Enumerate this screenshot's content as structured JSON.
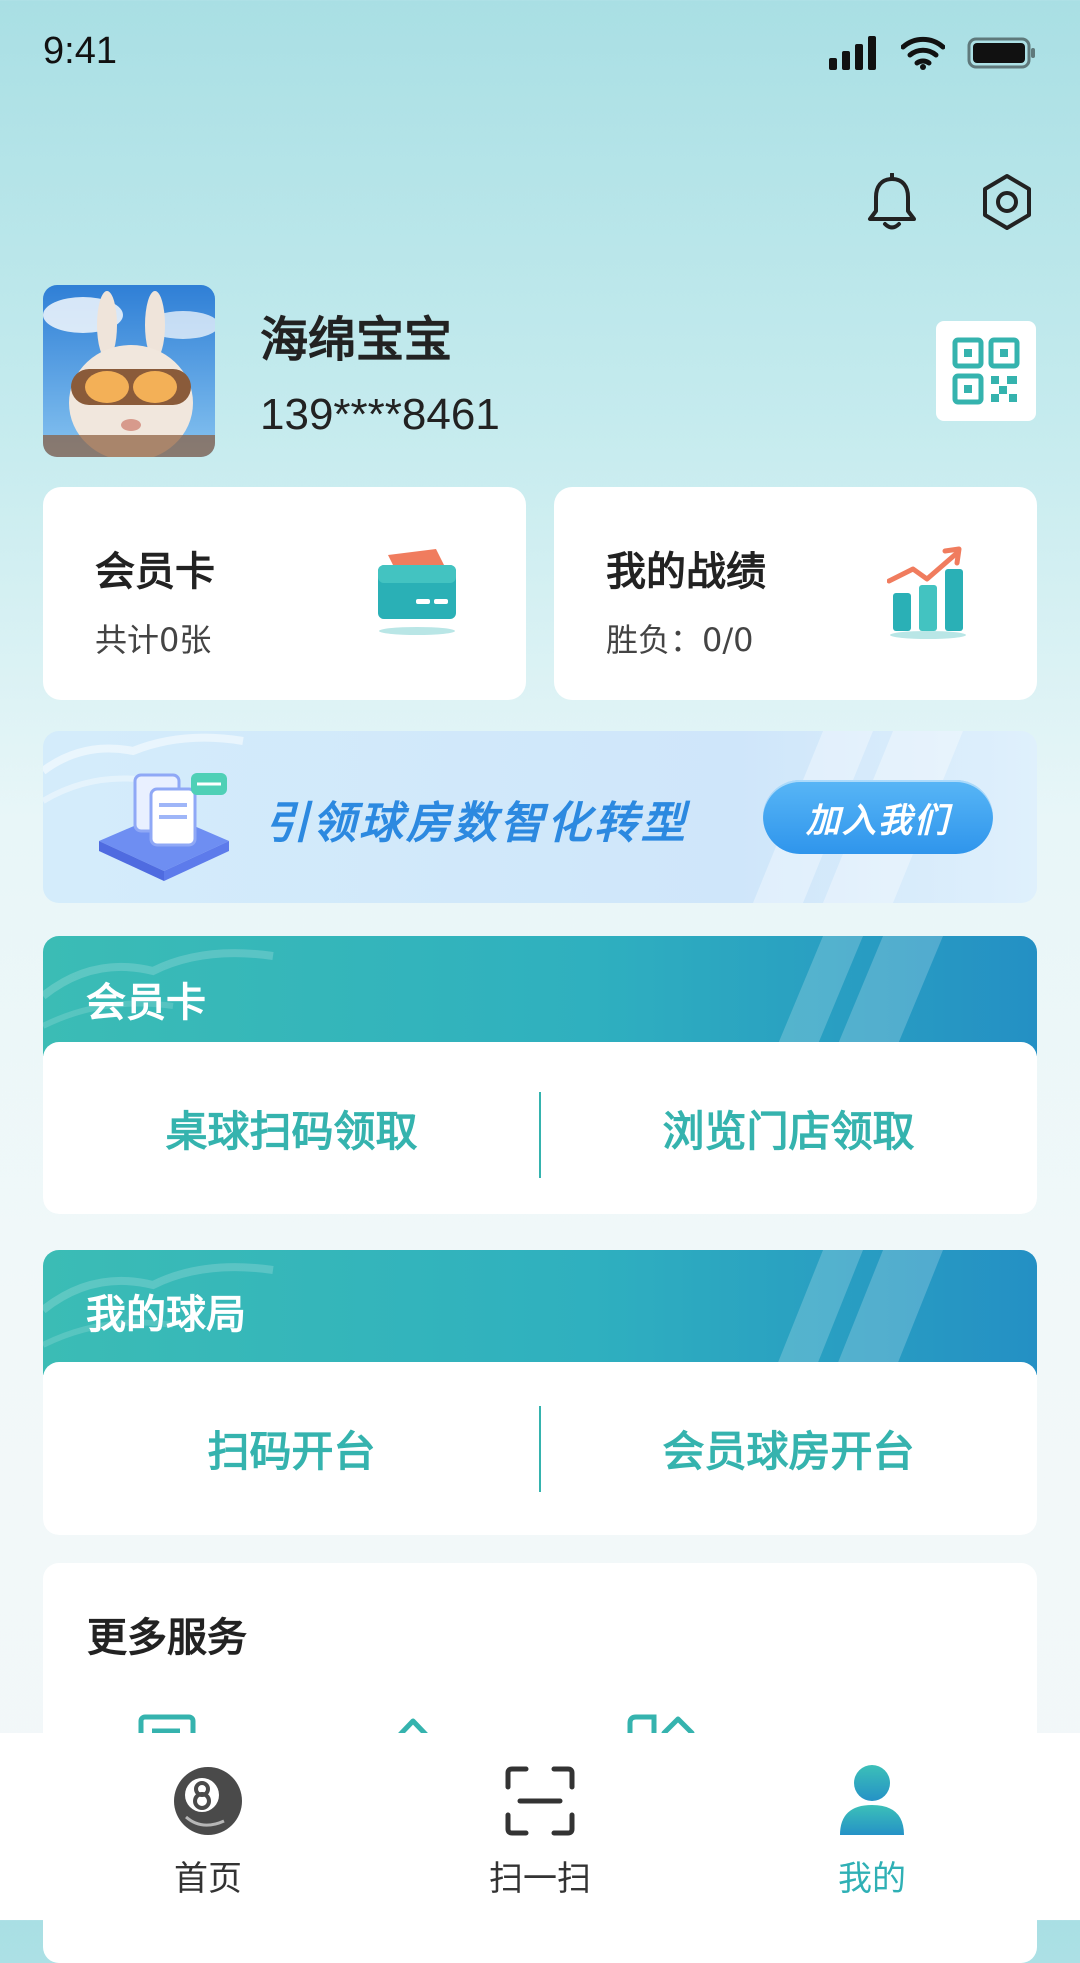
{
  "status_bar": {
    "time": "9:41"
  },
  "profile": {
    "name": "海绵宝宝",
    "phone": "139****8461"
  },
  "stats": [
    {
      "title": "会员卡",
      "subtitle": "共计0张"
    },
    {
      "title": "我的战绩",
      "subtitle": "胜负：0/0"
    }
  ],
  "banner": {
    "text": "引领球房数智化转型",
    "button": "加入我们"
  },
  "member_card_section": {
    "title": "会员卡",
    "links": [
      "桌球扫码领取",
      "浏览门店领取"
    ]
  },
  "games_section": {
    "title": "我的球局",
    "links": [
      "扫码开台",
      "会员球房开台"
    ]
  },
  "more_services": {
    "title": "更多服务"
  },
  "tabbar": {
    "items": [
      {
        "label": "首页",
        "icon": "billiard-ball-icon",
        "active": false
      },
      {
        "label": "扫一扫",
        "icon": "scan-icon",
        "active": false
      },
      {
        "label": "我的",
        "icon": "user-icon",
        "active": true
      }
    ]
  },
  "colors": {
    "accent": "#35b3ae",
    "banner_blue": "#2c89e0",
    "active_tab": "#2fb0b5"
  }
}
